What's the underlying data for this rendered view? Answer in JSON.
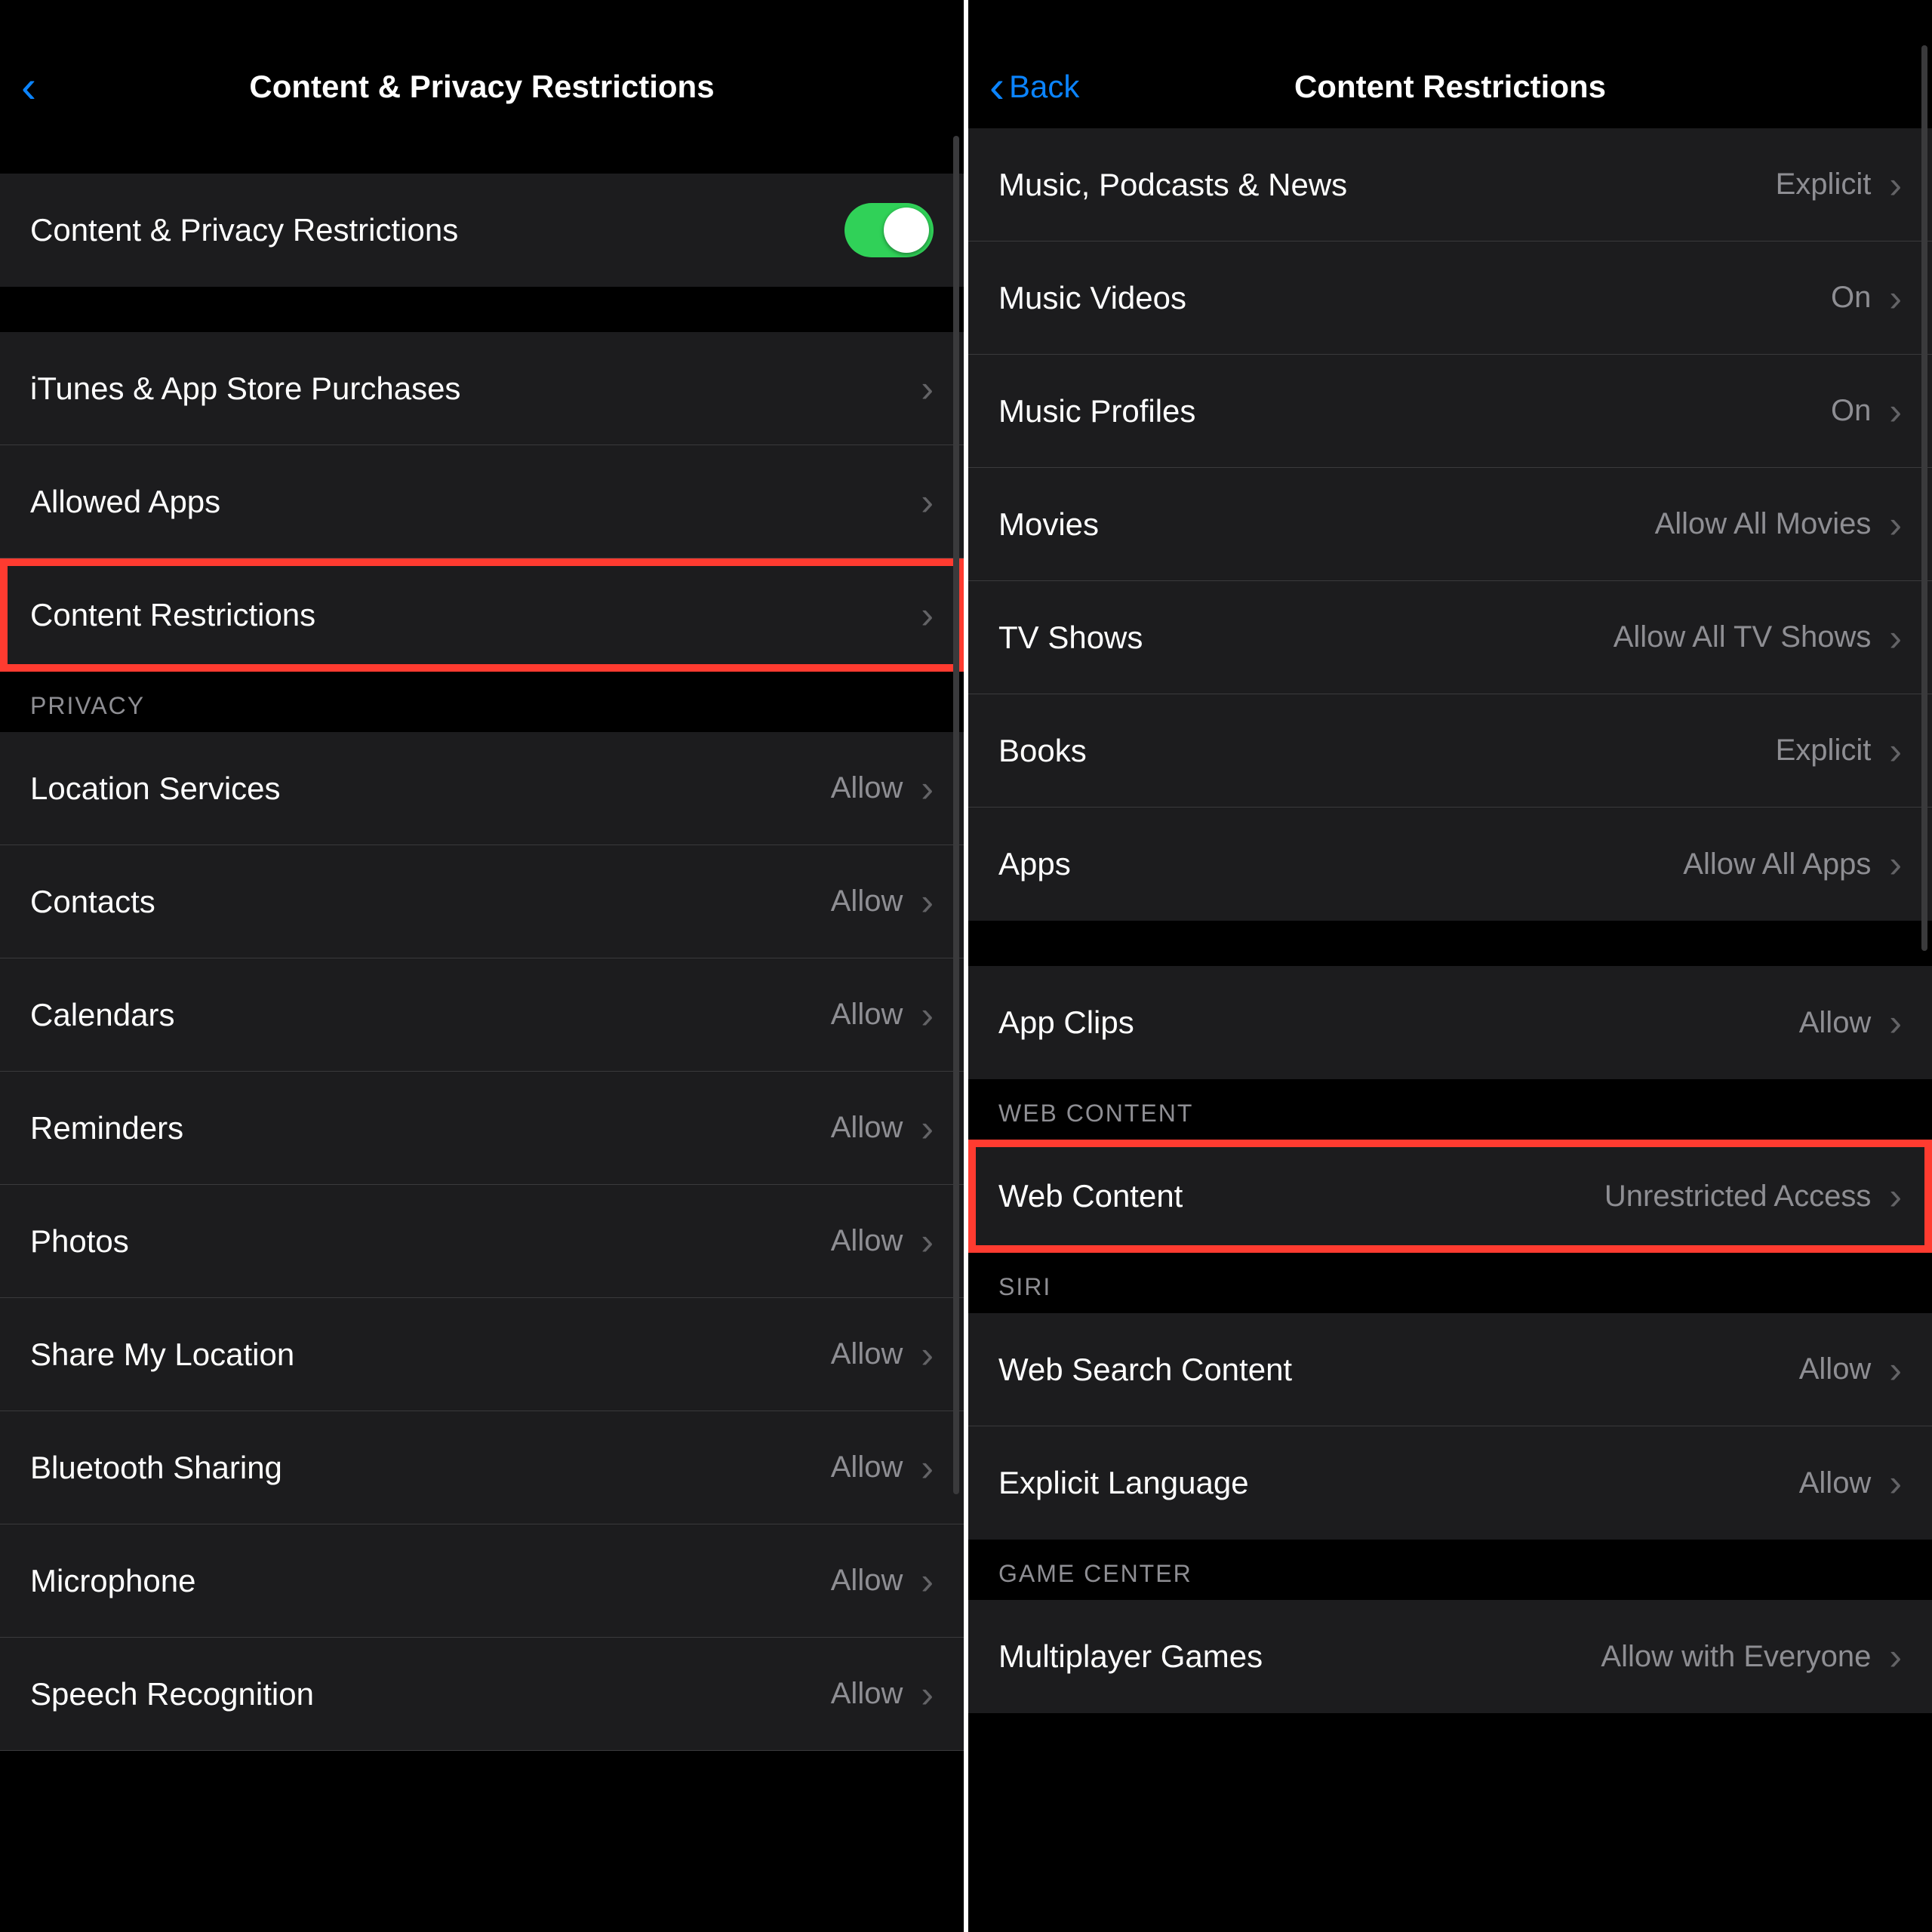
{
  "left": {
    "title": "Content & Privacy Restrictions",
    "master_toggle": {
      "label": "Content & Privacy Restrictions",
      "on": true
    },
    "group1": [
      {
        "label": "iTunes & App Store Purchases",
        "value": "",
        "highlight": false
      },
      {
        "label": "Allowed Apps",
        "value": "",
        "highlight": false
      },
      {
        "label": "Content Restrictions",
        "value": "",
        "highlight": true
      }
    ],
    "privacy_header": "PRIVACY",
    "privacy": [
      {
        "label": "Location Services",
        "value": "Allow"
      },
      {
        "label": "Contacts",
        "value": "Allow"
      },
      {
        "label": "Calendars",
        "value": "Allow"
      },
      {
        "label": "Reminders",
        "value": "Allow"
      },
      {
        "label": "Photos",
        "value": "Allow"
      },
      {
        "label": "Share My Location",
        "value": "Allow"
      },
      {
        "label": "Bluetooth Sharing",
        "value": "Allow"
      },
      {
        "label": "Microphone",
        "value": "Allow"
      },
      {
        "label": "Speech Recognition",
        "value": "Allow"
      }
    ]
  },
  "right": {
    "back_label": "Back",
    "title": "Content Restrictions",
    "media": [
      {
        "label": "Music, Podcasts & News",
        "value": "Explicit"
      },
      {
        "label": "Music Videos",
        "value": "On"
      },
      {
        "label": "Music Profiles",
        "value": "On"
      },
      {
        "label": "Movies",
        "value": "Allow All Movies"
      },
      {
        "label": "TV Shows",
        "value": "Allow All TV Shows"
      },
      {
        "label": "Books",
        "value": "Explicit"
      },
      {
        "label": "Apps",
        "value": "Allow All Apps"
      }
    ],
    "app_clips": {
      "label": "App Clips",
      "value": "Allow"
    },
    "web_header": "WEB CONTENT",
    "web": [
      {
        "label": "Web Content",
        "value": "Unrestricted Access",
        "highlight": true
      }
    ],
    "siri_header": "SIRI",
    "siri": [
      {
        "label": "Web Search Content",
        "value": "Allow"
      },
      {
        "label": "Explicit Language",
        "value": "Allow"
      }
    ],
    "gc_header": "GAME CENTER",
    "gc": [
      {
        "label": "Multiplayer Games",
        "value": "Allow with Everyone"
      }
    ]
  }
}
